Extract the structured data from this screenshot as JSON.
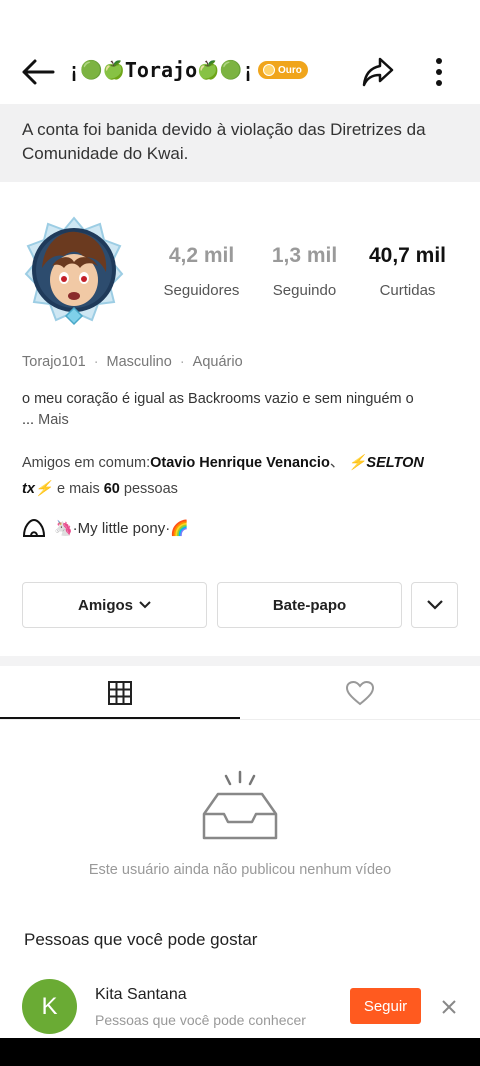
{
  "header": {
    "title_prefix": "¡",
    "emoji_1": "🟢",
    "emoji_2": "🍏",
    "title_name": "Torajo",
    "emoji_3": "🍏",
    "emoji_4": "🟢",
    "title_suffix": "¡",
    "badge_label": "Ouro",
    "back_icon": "arrow-left-icon",
    "share_icon": "share-arrow-icon",
    "more_icon": "vertical-dots-icon"
  },
  "ban_notice": "A conta foi banida devido à violação das Diretrizes da Comunidade do Kwai.",
  "stats": [
    {
      "value": "4,2 mil",
      "label": "Seguidores"
    },
    {
      "value": "1,3 mil",
      "label": "Seguindo"
    },
    {
      "value": "40,7 mil",
      "label": "Curtidas"
    }
  ],
  "profile": {
    "username": "Torajo101",
    "gender": "Masculino",
    "sign": "Aquário",
    "separator": "·",
    "bio": "o meu coração é igual as Backrooms vazio e sem ninguém o",
    "bio_ellipsis": "...",
    "bio_more": "Mais",
    "friends_prefix": "Amigos em comum:",
    "friend_1": "Otavio Henrique Venancio",
    "friend_sep": "、",
    "friend_2": "⚡SELTON tx⚡",
    "friends_and": "e mais",
    "friends_count": "60",
    "friends_suffix": "pessoas",
    "tag": "🦄·My little pony·🌈"
  },
  "buttons": {
    "friends": "Amigos",
    "chat": "Bate-papo"
  },
  "tabs": {
    "videos_icon": "grid-icon",
    "liked_icon": "heart-icon"
  },
  "empty_state": "Este usuário ainda não publicou nenhum vídeo",
  "suggestions": {
    "title": "Pessoas que você pode gostar",
    "items": [
      {
        "initial": "K",
        "name": "Kita Santana",
        "subtitle": "Pessoas que você pode conhecer",
        "action": "Seguir"
      }
    ]
  },
  "colors": {
    "accent": "#ff5a1f",
    "badge": "#f0a51c",
    "avatar_bg": "#6aab34"
  }
}
